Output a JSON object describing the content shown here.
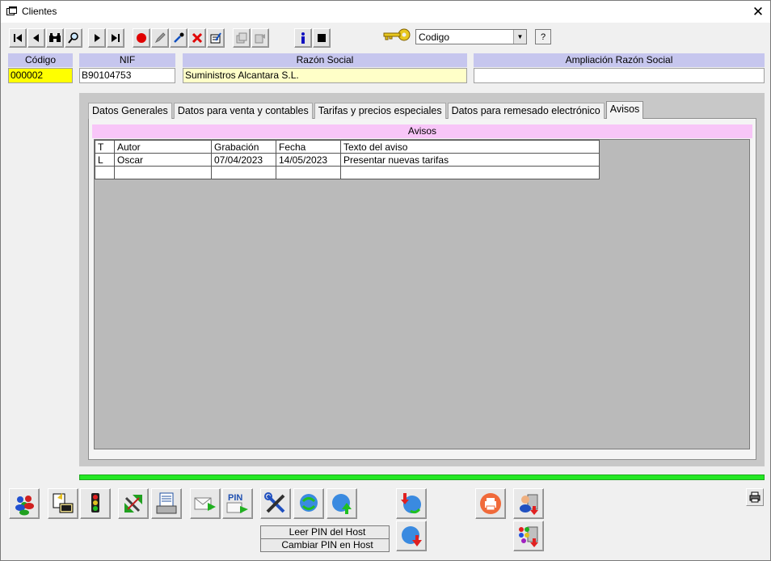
{
  "window": {
    "title": "Clientes",
    "close_label": "✕"
  },
  "search": {
    "field_value": "Codigo",
    "help_label": "?"
  },
  "fields": {
    "codigo": {
      "label": "Código",
      "value": "000002"
    },
    "nif": {
      "label": "NIF",
      "value": "B90104753"
    },
    "razon_social": {
      "label": "Razón Social",
      "value": "Suministros Alcantara S.L."
    },
    "ampliacion": {
      "label": "Ampliación Razón Social",
      "value": ""
    }
  },
  "tabs": [
    {
      "label": "Datos Generales"
    },
    {
      "label": "Datos para venta y contables"
    },
    {
      "label": "Tarifas y precios especiales"
    },
    {
      "label": "Datos para remesado electrónico"
    },
    {
      "label": "Avisos"
    }
  ],
  "avisos": {
    "header": "Avisos",
    "columns": [
      "T",
      "Autor",
      "Grabación",
      "Fecha",
      "Texto del aviso"
    ],
    "rows": [
      [
        "L",
        "Oscar",
        "07/04/2023",
        "14/05/2023",
        "Presentar nuevas tarifas"
      ],
      [
        "",
        "",
        "",
        "",
        ""
      ]
    ]
  },
  "pin": {
    "read_label": "Leer PIN del Host",
    "change_label": "Cambiar PIN en Host"
  },
  "colors": {
    "field_header": "#c6c6ee",
    "codigo_bg": "#ffff00",
    "razon_bg": "#ffffc8",
    "avisos_header": "#f8c6f8",
    "status_bar": "#24e824"
  }
}
